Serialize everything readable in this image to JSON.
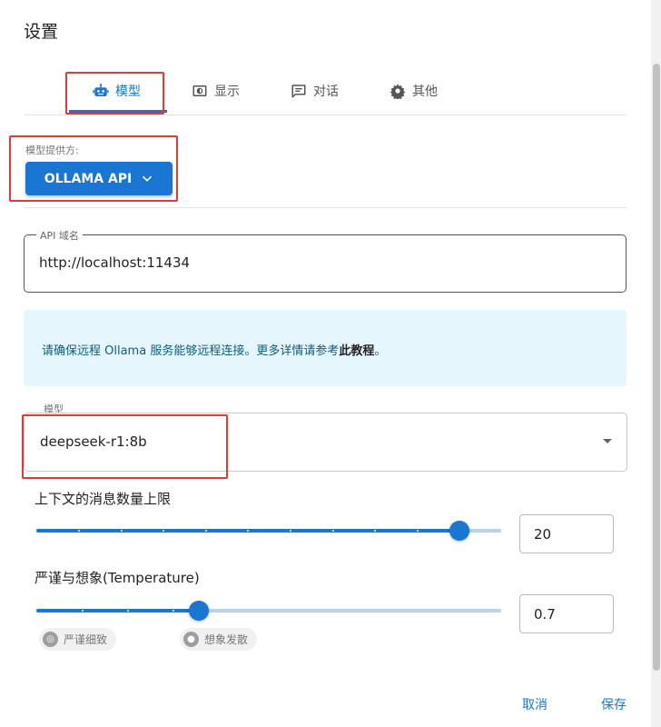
{
  "dialog": {
    "title": "设置"
  },
  "tabs": [
    {
      "label": "模型",
      "icon": "robot-icon",
      "active": true
    },
    {
      "label": "显示",
      "icon": "display-icon"
    },
    {
      "label": "对话",
      "icon": "chat-icon"
    },
    {
      "label": "其他",
      "icon": "gear-icon"
    }
  ],
  "provider": {
    "label": "模型提供方:",
    "value": "OLLAMA API"
  },
  "api_host": {
    "label": "API 域名",
    "value": "http://localhost:11434"
  },
  "info": {
    "text": "请确保远程 Ollama 服务能够远程连接。更多详情请参考",
    "link": "此教程",
    "suffix": "。"
  },
  "model": {
    "label": "模型",
    "value": "deepseek-r1:8b"
  },
  "context_limit": {
    "label": "上下文的消息数量上限",
    "value": "20",
    "fraction": 0.91
  },
  "temperature": {
    "label": "严谨与想象(Temperature)",
    "value": "0.7",
    "fraction": 0.35,
    "chip_precise": "严谨细致",
    "chip_creative": "想象发散"
  },
  "footer": {
    "cancel": "取消",
    "save": "保存"
  },
  "colors": {
    "accent": "#1976d2",
    "highlight": "#e53935",
    "info_bg": "#e5f6fd"
  }
}
